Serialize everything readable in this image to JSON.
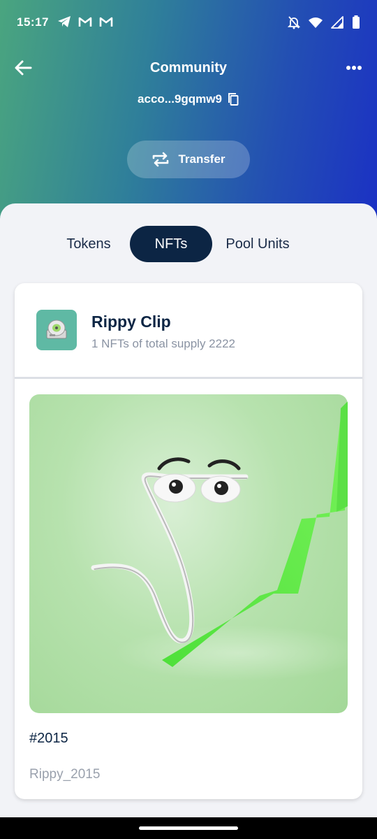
{
  "status_bar": {
    "time": "15:17",
    "left_icons": [
      "telegram-icon",
      "gmail-icon",
      "gmail-icon"
    ],
    "right_icons": [
      "bell-off-icon",
      "wifi-icon",
      "signal-icon",
      "battery-icon"
    ]
  },
  "header": {
    "title": "Community",
    "address": "acco...9gqmw9",
    "transfer_label": "Transfer"
  },
  "tabs": {
    "items": [
      {
        "label": "Tokens",
        "active": false
      },
      {
        "label": "NFTs",
        "active": true
      },
      {
        "label": "Pool Units",
        "active": false
      }
    ]
  },
  "collection": {
    "name": "Rippy Clip",
    "supply_text": "1 NFTs of total supply 2222",
    "icon": "disc-icon"
  },
  "nft": {
    "id": "#2015",
    "name": "Rippy_2015",
    "image": "paperclip-character-rising-green-arrow"
  },
  "colors": {
    "gradient_start": "#4aa57f",
    "gradient_end": "#1b31c4",
    "active_tab": "#0c2544",
    "text_primary": "#0c2544",
    "text_secondary": "#8a93a3",
    "collection_icon_bg": "#5fb9a4"
  }
}
